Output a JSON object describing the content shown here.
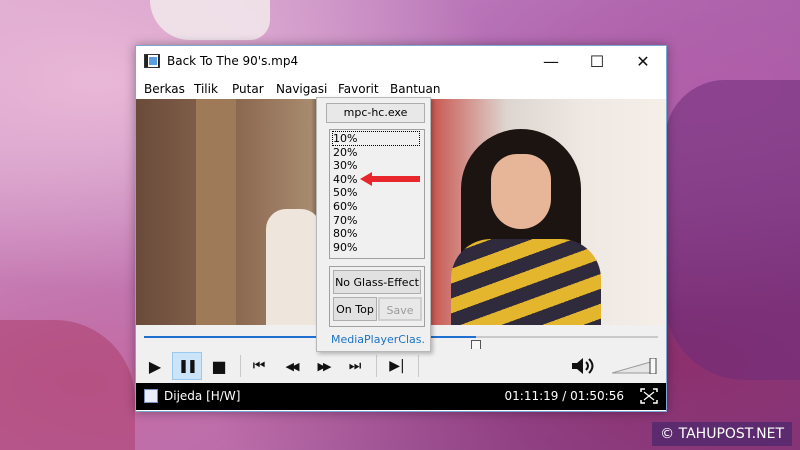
{
  "window": {
    "title": "Back To The 90's.mp4",
    "controls": {
      "minimize": "—",
      "maximize": "☐",
      "close": "✕"
    }
  },
  "menu": [
    "Berkas",
    "Tilik",
    "Putar",
    "Navigasi",
    "Favorit",
    "Bantuan"
  ],
  "context_menu": {
    "title": "mpc-hc.exe",
    "opacity_options": [
      "10%",
      "20%",
      "30%",
      "40%",
      "50%",
      "60%",
      "70%",
      "80%",
      "90%"
    ],
    "selected_index": 0,
    "glass_button": "No Glass-Effect",
    "ontop_button": "On Top",
    "save_button": "Save",
    "link": "MediaPlayerClas..."
  },
  "seek": {
    "position_fraction": 0.646
  },
  "playback_controls": {
    "play": "▶",
    "pause": "❚❚",
    "stop": "■",
    "prev": "⏮",
    "rewind": "◀◀",
    "forward": "▶▶",
    "next": "⏭",
    "frame_step": "▶|",
    "volume_icon": "speaker-icon"
  },
  "status": {
    "text": "Dijeda [H/W]",
    "time": "01:11:19 / 01:50:56"
  },
  "watermark": "© TAHUPOST.NET",
  "colors": {
    "accent": "#1e6fd0",
    "arrow": "#e8262c",
    "link": "#1a73c5"
  }
}
